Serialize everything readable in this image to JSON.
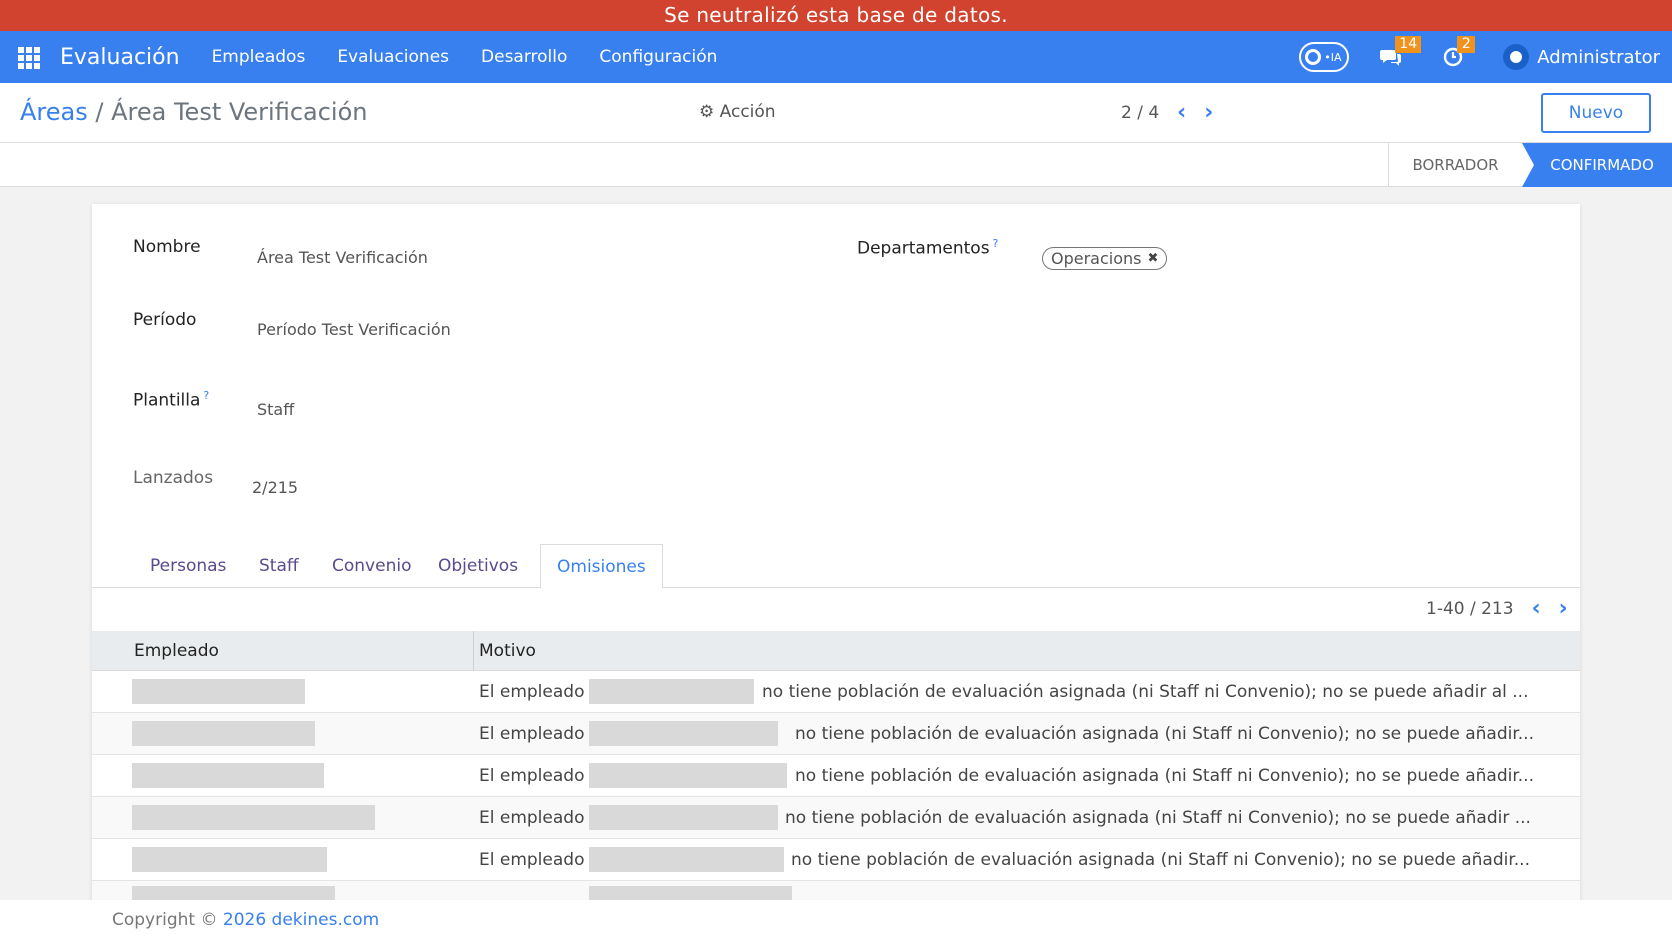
{
  "banner": {
    "text": "Se neutralizó esta base de datos."
  },
  "navbar": {
    "app_name": "Evaluación",
    "menu": [
      "Empleados",
      "Evaluaciones",
      "Desarrollo",
      "Configuración"
    ],
    "ia_label": "IA",
    "messages_count": "14",
    "activities_count": "2",
    "user_name": "Administrator"
  },
  "breadcrumb": {
    "parent": "Áreas",
    "separator": "/",
    "current": "Área Test Verificación"
  },
  "toolbar": {
    "action_label": "Acción",
    "pager": "2 / 4",
    "new_label": "Nuevo"
  },
  "status": {
    "stages": [
      "BORRADOR",
      "CONFIRMADO"
    ],
    "active": "CONFIRMADO"
  },
  "form": {
    "nombre_label": "Nombre",
    "nombre_value": "Área Test Verificación",
    "periodo_label": "Período",
    "periodo_value": "Período Test Verificación",
    "plantilla_label": "Plantilla",
    "plantilla_value": "Staff",
    "lanzados_label": "Lanzados",
    "lanzados_value": "2/215",
    "departamentos_label": "Departamentos",
    "departamentos_tags": [
      "Operacions"
    ],
    "help_mark": "?"
  },
  "tabs": [
    "Personas",
    "Staff",
    "Convenio",
    "Objetivos",
    "Omisiones"
  ],
  "active_tab": "Omisiones",
  "list": {
    "pager": "1-40 / 213",
    "columns": [
      "Empleado",
      "Motivo"
    ],
    "rows": [
      {
        "prefix": "El empleado",
        "suffix": "no tiene población de evaluación asignada (ni Staff ni Convenio); no se puede añadir al ..."
      },
      {
        "prefix": "El empleado",
        "suffix": "no tiene población de evaluación asignada (ni Staff ni Convenio); no se puede añadir..."
      },
      {
        "prefix": "El empleado",
        "suffix": "no tiene población de evaluación asignada (ni Staff ni Convenio); no se puede añadir..."
      },
      {
        "prefix": "El empleado",
        "suffix": "no tiene población de evaluación asignada (ni Staff ni Convenio); no se puede añadir ..."
      },
      {
        "prefix": "El empleado",
        "suffix": "no tiene población de evaluación asignada (ni Staff ni Convenio); no se puede añadir..."
      }
    ]
  },
  "footer": {
    "prefix": "Copyright ©",
    "link": "2026 dekines.com"
  },
  "colors": {
    "banner": "#d1432e",
    "primary": "#3880f0",
    "badge": "#f0921e"
  }
}
